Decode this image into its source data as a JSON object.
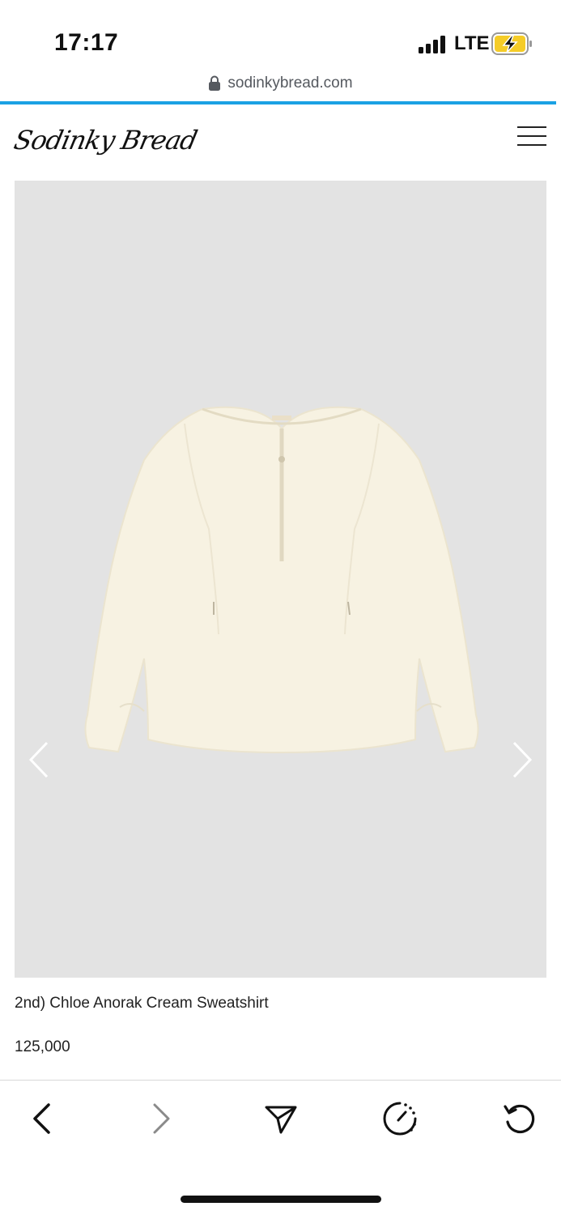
{
  "status_bar": {
    "time": "17:17",
    "network": "LTE",
    "icons": [
      "signal-icon",
      "battery-charging-icon"
    ]
  },
  "browser": {
    "url": "sodinkybread.com",
    "lock_icon": "lock-icon",
    "progress_color": "#1aa1e4"
  },
  "header": {
    "logo_text": "Sodinky Bread",
    "menu_icon": "hamburger-menu-icon"
  },
  "product": {
    "title": "2nd) Chloe Anorak Cream Sweatshirt",
    "price": "125,000",
    "image_bg": "#e3e3e3",
    "garment_color": "#f7f2e2"
  },
  "carousel": {
    "prev_icon": "chevron-left-icon",
    "next_icon": "chevron-right-icon"
  },
  "toolbar": {
    "items": [
      "back-icon",
      "forward-icon",
      "share-icon",
      "speed-icon",
      "reload-icon"
    ]
  }
}
